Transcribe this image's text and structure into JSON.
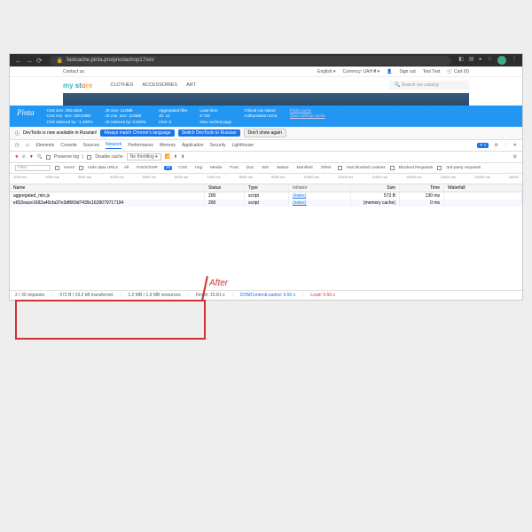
{
  "chrome": {
    "url": "fastcache.pinta.pro/prestashop17/en/"
  },
  "topbar": {
    "contact": "Contact us",
    "language": "English ▾",
    "currency_label": "Currency:",
    "currency": "UAH ₴ ▾",
    "signout": "Sign out",
    "user": "Test Test",
    "cart": "Cart (0)"
  },
  "logo": {
    "my": "my",
    "st": " st",
    "o": "o",
    "re": "re"
  },
  "nav": {
    "clothes": "CLOTHES",
    "accessories": "ACCESSORIES",
    "art": "ART"
  },
  "search": {
    "placeholder": "Search our catalog"
  },
  "pinta": {
    "name": "Pinta",
    "css1": "CSS size: 255.62kB",
    "css2": "CSS min. size: 258.93kB",
    "css3": "CSS reduced by: -1.292%",
    "js1": "JS size: 114MB",
    "js2": "JS min. size: 113MB",
    "js3": "JS reduces by: 0.529%",
    "agg1": "Aggregated files",
    "agg2": "JS: 14",
    "agg3": "CSS: 8",
    "load1": "Load time:",
    "load2": "8.725",
    "load3": "New cached page",
    "crit1": "Critical css status:",
    "crit2": "Authorisation Error",
    "flush": "Flush cache",
    "open": "Open without cache"
  },
  "notice": {
    "text": "DevTools is now available in Russian!",
    "btn1": "Always match Chrome's language",
    "btn2": "Switch DevTools to Russian",
    "btn3": "Don't show again"
  },
  "tabs": {
    "elements": "Elements",
    "console": "Console",
    "sources": "Sources",
    "network": "Network",
    "performance": "Performance",
    "memory": "Memory",
    "application": "Application",
    "security": "Security",
    "lighthouse": "Lighthouse",
    "badge": "1"
  },
  "toolbar": {
    "preserve": "Preserve log",
    "disable": "Disable cache",
    "throttle": "No throttling ▾"
  },
  "filter": {
    "label": "Filter",
    "invert": "Invert",
    "hide": "Hide data URLs",
    "all": "All",
    "fetch": "Fetch/XHR",
    "js": "JS",
    "css": "CSS",
    "img": "Img",
    "media": "Media",
    "font": "Font",
    "doc": "Doc",
    "ws": "WS",
    "wasm": "Wasm",
    "manifest": "Manifest",
    "other": "Other",
    "blocked_cookies": "Has blocked cookies",
    "blocked_req": "Blocked Requests",
    "third": "3rd-party requests"
  },
  "timeline": [
    "1000 ms",
    "2000 ms",
    "3000 ms",
    "4000 ms",
    "5000 ms",
    "6000 ms",
    "7000 ms",
    "8000 ms",
    "9000 ms",
    "10000 ms",
    "11000 ms",
    "12000 ms",
    "13000 ms",
    "14000 ms",
    "15000 ms",
    "16000"
  ],
  "annotation": {
    "after": "After"
  },
  "table": {
    "head": {
      "name": "Name",
      "status": "Status",
      "type": "Type",
      "initiator": "Initiator",
      "size": "Size",
      "time": "Time",
      "waterfall": "Waterfall"
    },
    "rows": [
      {
        "name": "aggregated_min.js",
        "status": "200",
        "type": "script",
        "initiator": "(index)",
        "size": "572 B",
        "time": "130 ms"
      },
      {
        "name": "e652eace1692a40cfa37e3df669d7439c1639079717194",
        "status": "200",
        "type": "script",
        "initiator": "(index)",
        "size": "(memory cache)",
        "time": "0 ms"
      }
    ]
  },
  "status": {
    "requests": "2 / 30 requests",
    "transferred": "572 B / 19.2 kB transferred",
    "resources": "1.2 MB / 1.9 MB resources",
    "finish": "Finish: 15.81 s",
    "dom": "DOMContentLoaded: 9.56 s",
    "load": "Load: 9.56 s"
  }
}
